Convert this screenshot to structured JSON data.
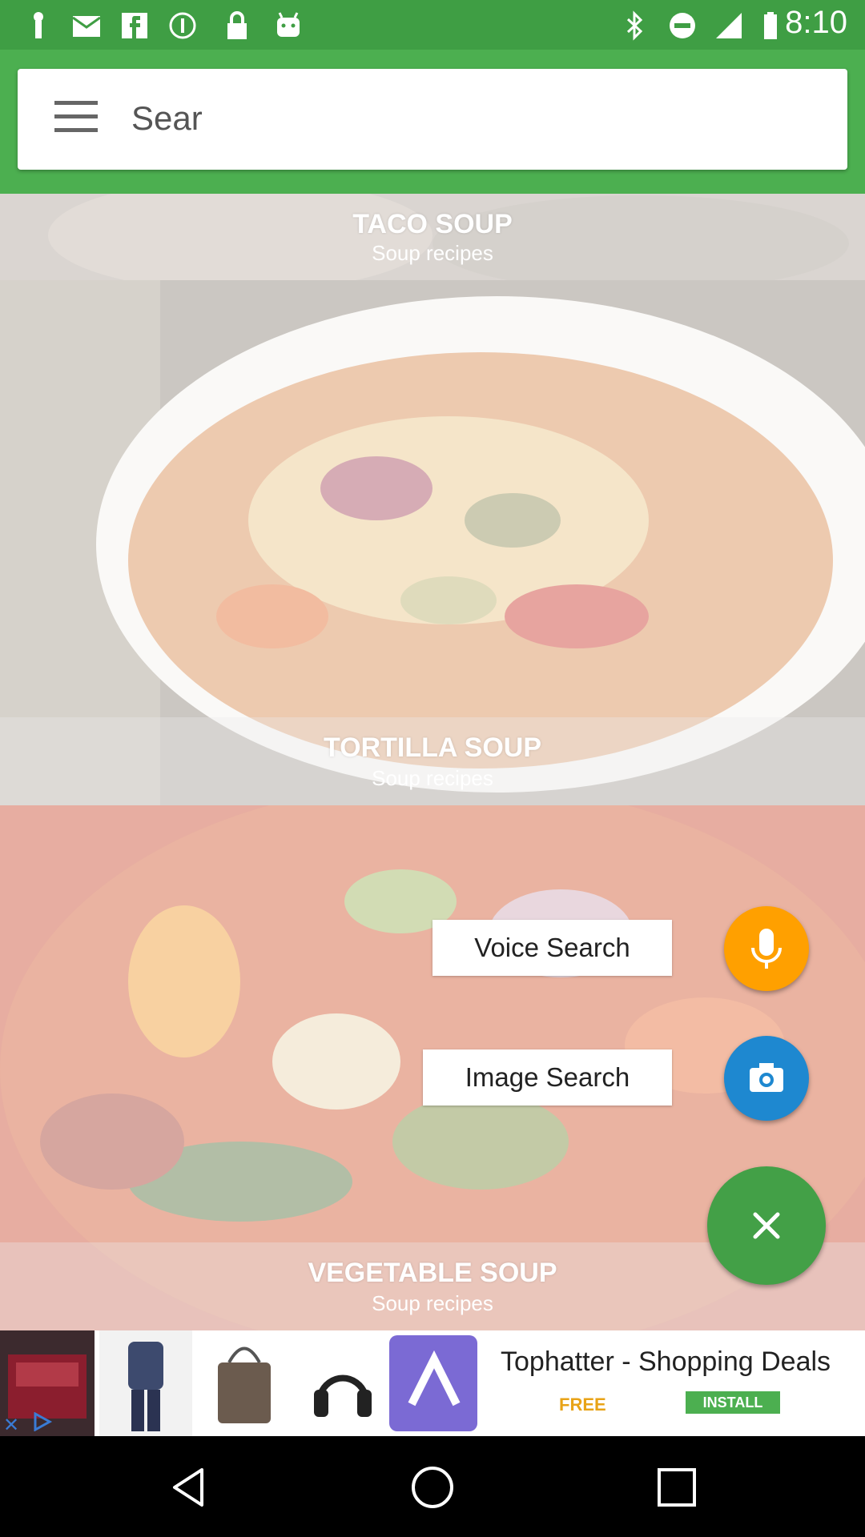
{
  "status_bar": {
    "time": "8:10",
    "left_icons": [
      "notification-icon",
      "mail-icon",
      "facebook-icon",
      "sync-icon",
      "lock-icon",
      "android-icon"
    ],
    "right_icons": [
      "bluetooth-icon",
      "do-not-disturb-icon",
      "signal-icon",
      "battery-icon"
    ]
  },
  "header": {
    "search_text": "Sear"
  },
  "recipes": [
    {
      "title": "TACO SOUP",
      "subtitle": "Soup recipes"
    },
    {
      "title": "TORTILLA SOUP",
      "subtitle": "Soup recipes"
    },
    {
      "title": "VEGETABLE SOUP",
      "subtitle": "Soup recipes"
    }
  ],
  "fab_menu": {
    "voice_label": "Voice Search",
    "image_label": "Image Search",
    "colors": {
      "voice": "#ffa000",
      "image": "#1e88d0",
      "close": "#43a047"
    }
  },
  "ad": {
    "title": "Tophatter - Shopping Deals",
    "price": "FREE",
    "cta": "INSTALL"
  },
  "colors": {
    "primary": "#4caf50",
    "status_bar": "#3f9e44"
  }
}
